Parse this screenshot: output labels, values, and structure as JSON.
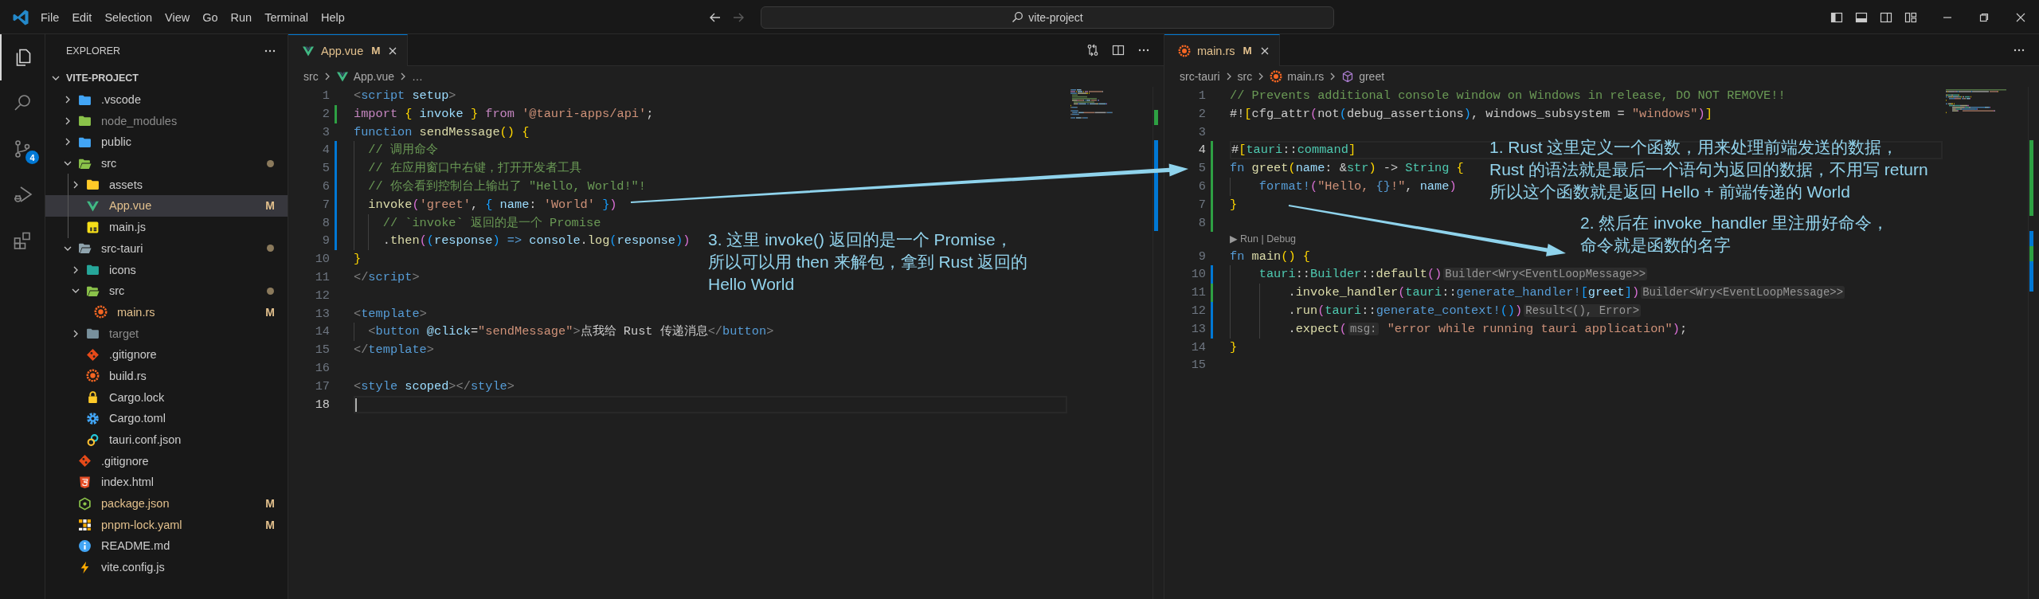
{
  "title_bar": {
    "menus": [
      "File",
      "Edit",
      "Selection",
      "View",
      "Go",
      "Run",
      "Terminal",
      "Help"
    ],
    "search": "vite-project"
  },
  "activity_bar": {
    "items": [
      {
        "selected": true
      },
      {
        "selected": false
      },
      {
        "selected": false,
        "badge": "4"
      },
      {
        "selected": false
      },
      {
        "selected": false
      }
    ]
  },
  "explorer": {
    "title": "EXPLORER",
    "root": {
      "name": "VITE-PROJECT",
      "expanded": true,
      "children": [
        {
          "name": ".vscode",
          "kind": "folder",
          "color": "#42a5f5",
          "expanded": false,
          "modified": false,
          "selected": false,
          "ignored": false
        },
        {
          "name": "node_modules",
          "kind": "folder",
          "color": "#8bc34a",
          "expanded": false,
          "modified": false,
          "selected": false,
          "ignored": true
        },
        {
          "name": "public",
          "kind": "folder",
          "color": "#42a5f5",
          "expanded": false,
          "modified": false,
          "selected": false,
          "ignored": false
        },
        {
          "name": "src",
          "kind": "folder",
          "color": "#8bc34a",
          "expanded": true,
          "modified": true,
          "selected": false,
          "ignored": false,
          "children": [
            {
              "name": "assets",
              "kind": "folder",
              "color": "#ffca28",
              "expanded": false,
              "modified": false,
              "selected": false,
              "ignored": false
            },
            {
              "name": "App.vue",
              "kind": "vue",
              "status": "M",
              "selected": true,
              "ignored": false
            },
            {
              "name": "main.js",
              "kind": "js",
              "selected": false,
              "ignored": false
            }
          ]
        },
        {
          "name": "src-tauri",
          "kind": "folder",
          "color": "#90a4ae",
          "expanded": true,
          "modified": true,
          "selected": false,
          "ignored": false,
          "children": [
            {
              "name": "icons",
              "kind": "folder",
              "color": "#26a69a",
              "expanded": false,
              "modified": false,
              "selected": false,
              "ignored": false
            },
            {
              "name": "src",
              "kind": "folder",
              "color": "#8bc34a",
              "expanded": true,
              "modified": true,
              "selected": false,
              "ignored": false,
              "children": [
                {
                  "name": "main.rs",
                  "kind": "rust",
                  "status": "M",
                  "selected": false,
                  "ignored": false
                }
              ]
            },
            {
              "name": "target",
              "kind": "folder",
              "color": "#78909c",
              "expanded": false,
              "modified": false,
              "selected": false,
              "ignored": true
            },
            {
              "name": ".gitignore",
              "kind": "git",
              "selected": false,
              "ignored": false
            },
            {
              "name": "build.rs",
              "kind": "rust",
              "selected": false,
              "ignored": false
            },
            {
              "name": "Cargo.lock",
              "kind": "lock",
              "selected": false,
              "ignored": false
            },
            {
              "name": "Cargo.toml",
              "kind": "toml",
              "selected": false,
              "ignored": false
            },
            {
              "name": "tauri.conf.json",
              "kind": "tauri",
              "selected": false,
              "ignored": false
            }
          ]
        },
        {
          "name": ".gitignore",
          "kind": "git",
          "selected": false,
          "ignored": false
        },
        {
          "name": "index.html",
          "kind": "html",
          "selected": false,
          "ignored": false
        },
        {
          "name": "package.json",
          "kind": "npm",
          "status": "M",
          "selected": false,
          "ignored": false
        },
        {
          "name": "pnpm-lock.yaml",
          "kind": "yaml",
          "status": "M",
          "selected": false,
          "ignored": false
        },
        {
          "name": "README.md",
          "kind": "info",
          "selected": false,
          "ignored": false
        },
        {
          "name": "vite.config.js",
          "kind": "vite",
          "selected": false,
          "ignored": false
        }
      ]
    }
  },
  "editors": [
    {
      "tab": {
        "label": "App.vue",
        "kind": "vue",
        "status": "M",
        "selected": true
      },
      "breadcrumb": [
        {
          "label": "src",
          "kind": "folder"
        },
        {
          "label": "App.vue",
          "kind": "vue"
        },
        {
          "label": "…",
          "kind": "more"
        }
      ],
      "lines": [
        {
          "kind": "code",
          "number": "1",
          "current": false,
          "tokens": [
            {
              "kind": "tag-punct",
              "text": "<"
            },
            {
              "kind": "tag",
              "text": "script"
            },
            {
              "kind": "attribute",
              "text": " setup"
            },
            {
              "kind": "tag-punct",
              "text": ">"
            }
          ]
        },
        {
          "kind": "code",
          "number": "2",
          "current": false,
          "color": "#2ea043",
          "tokens": [
            {
              "kind": "keyword",
              "text": "import"
            },
            {
              "kind": "bracket-1",
              "text": " {"
            },
            {
              "kind": "variable",
              "text": " invoke"
            },
            {
              "kind": "bracket-1",
              "text": " }"
            },
            {
              "kind": "keyword",
              "text": " from"
            },
            {
              "kind": "string",
              "text": " '@tauri-apps/api'"
            },
            {
              "kind": "plain",
              "text": ";"
            }
          ]
        },
        {
          "kind": "code",
          "number": "3",
          "current": false,
          "tokens": [
            {
              "kind": "storage",
              "text": "function"
            },
            {
              "kind": "function",
              "text": " sendMessage"
            },
            {
              "kind": "bracket-1",
              "text": "()"
            },
            {
              "kind": "bracket-1",
              "text": " {"
            }
          ]
        },
        {
          "kind": "code",
          "number": "4",
          "current": false,
          "color": "#0078d4",
          "tokens": [
            {
              "kind": "comment",
              "text": "  // 调用命令"
            }
          ]
        },
        {
          "kind": "code",
          "number": "5",
          "current": false,
          "color": "#0078d4",
          "tokens": [
            {
              "kind": "comment",
              "text": "  // 在应用窗口中右键，打开开发者工具"
            }
          ]
        },
        {
          "kind": "code",
          "number": "6",
          "current": false,
          "color": "#0078d4",
          "tokens": [
            {
              "kind": "comment",
              "text": "  // 你会看到控制台上输出了 \"Hello, World!\"!"
            }
          ]
        },
        {
          "kind": "code",
          "number": "7",
          "current": false,
          "color": "#0078d4",
          "tokens": [
            {
              "kind": "function",
              "text": "  invoke"
            },
            {
              "kind": "bracket-2",
              "text": "("
            },
            {
              "kind": "string",
              "text": "'greet'"
            },
            {
              "kind": "plain",
              "text": ", "
            },
            {
              "kind": "bracket-3",
              "text": "{"
            },
            {
              "kind": "variable",
              "text": " name"
            },
            {
              "kind": "plain",
              "text": ": "
            },
            {
              "kind": "string",
              "text": "'World'"
            },
            {
              "kind": "bracket-3",
              "text": " }"
            },
            {
              "kind": "bracket-2",
              "text": ")"
            }
          ]
        },
        {
          "kind": "code",
          "number": "8",
          "current": false,
          "color": "#0078d4",
          "tokens": [
            {
              "kind": "comment",
              "text": "    // `invoke` 返回的是一个 Promise"
            }
          ]
        },
        {
          "kind": "code",
          "number": "9",
          "current": false,
          "color": "#0078d4",
          "tokens": [
            {
              "kind": "plain",
              "text": "    ."
            },
            {
              "kind": "function",
              "text": "then"
            },
            {
              "kind": "bracket-2",
              "text": "("
            },
            {
              "kind": "bracket-3",
              "text": "("
            },
            {
              "kind": "variable",
              "text": "response"
            },
            {
              "kind": "bracket-3",
              "text": ")"
            },
            {
              "kind": "storage",
              "text": " =>"
            },
            {
              "kind": "variable",
              "text": " console"
            },
            {
              "kind": "plain",
              "text": "."
            },
            {
              "kind": "function",
              "text": "log"
            },
            {
              "kind": "bracket-3",
              "text": "("
            },
            {
              "kind": "variable",
              "text": "response"
            },
            {
              "kind": "bracket-3",
              "text": ")"
            },
            {
              "kind": "bracket-2",
              "text": ")"
            }
          ]
        },
        {
          "kind": "code",
          "number": "10",
          "current": false,
          "tokens": [
            {
              "kind": "bracket-1",
              "text": "}"
            }
          ]
        },
        {
          "kind": "code",
          "number": "11",
          "current": false,
          "tokens": [
            {
              "kind": "tag-punct",
              "text": "</"
            },
            {
              "kind": "tag",
              "text": "script"
            },
            {
              "kind": "tag-punct",
              "text": ">"
            }
          ]
        },
        {
          "kind": "code",
          "number": "12",
          "current": false
        },
        {
          "kind": "code",
          "number": "13",
          "current": false,
          "tokens": [
            {
              "kind": "tag-punct",
              "text": "<"
            },
            {
              "kind": "tag",
              "text": "template"
            },
            {
              "kind": "tag-punct",
              "text": ">"
            }
          ]
        },
        {
          "kind": "code",
          "number": "14",
          "current": false,
          "tokens": [
            {
              "kind": "tag-punct",
              "text": "  <"
            },
            {
              "kind": "tag",
              "text": "button"
            },
            {
              "kind": "attribute",
              "text": " @click"
            },
            {
              "kind": "plain",
              "text": "="
            },
            {
              "kind": "string",
              "text": "\"sendMessage\""
            },
            {
              "kind": "tag-punct",
              "text": ">"
            },
            {
              "kind": "plain",
              "text": "点我给 Rust 传递消息"
            },
            {
              "kind": "tag-punct",
              "text": "</"
            },
            {
              "kind": "tag",
              "text": "button"
            },
            {
              "kind": "tag-punct",
              "text": ">"
            }
          ]
        },
        {
          "kind": "code",
          "number": "15",
          "current": false,
          "tokens": [
            {
              "kind": "tag-punct",
              "text": "</"
            },
            {
              "kind": "tag",
              "text": "template"
            },
            {
              "kind": "tag-punct",
              "text": ">"
            }
          ]
        },
        {
          "kind": "code",
          "number": "16",
          "current": false
        },
        {
          "kind": "code",
          "number": "17",
          "current": false,
          "tokens": [
            {
              "kind": "tag-punct",
              "text": "<"
            },
            {
              "kind": "tag",
              "text": "style"
            },
            {
              "kind": "attribute",
              "text": " scoped"
            },
            {
              "kind": "tag-punct",
              "text": "></"
            },
            {
              "kind": "tag",
              "text": "style"
            },
            {
              "kind": "tag-punct",
              "text": ">"
            }
          ]
        },
        {
          "kind": "code",
          "number": "18",
          "current": true
        }
      ]
    },
    {
      "tab": {
        "label": "main.rs",
        "kind": "rust",
        "status": "M",
        "selected": true
      },
      "breadcrumb": [
        {
          "label": "src-tauri",
          "kind": "folder"
        },
        {
          "label": "src",
          "kind": "folder"
        },
        {
          "label": "main.rs",
          "kind": "rust"
        },
        {
          "label": "greet",
          "kind": "symbol"
        }
      ],
      "lines": [
        {
          "kind": "code",
          "number": "1",
          "current": false,
          "tokens": [
            {
              "kind": "comment",
              "text": "// Prevents additional console window on Windows in release, DO NOT REMOVE!!"
            }
          ]
        },
        {
          "kind": "code",
          "number": "2",
          "current": false,
          "tokens": [
            {
              "kind": "plain",
              "text": "#!"
            },
            {
              "kind": "bracket-1",
              "text": "["
            },
            {
              "kind": "plain",
              "text": "cfg_attr"
            },
            {
              "kind": "bracket-2",
              "text": "("
            },
            {
              "kind": "plain",
              "text": "not"
            },
            {
              "kind": "bracket-3",
              "text": "("
            },
            {
              "kind": "plain",
              "text": "debug_assertions"
            },
            {
              "kind": "bracket-3",
              "text": ")"
            },
            {
              "kind": "plain",
              "text": ", windows_subsystem = "
            },
            {
              "kind": "string",
              "text": "\"windows\""
            },
            {
              "kind": "bracket-2",
              "text": ")"
            },
            {
              "kind": "bracket-1",
              "text": "]"
            }
          ]
        },
        {
          "kind": "code",
          "number": "3",
          "current": false
        },
        {
          "kind": "code",
          "number": "4",
          "current": true,
          "color": "#2ea043",
          "tokens": [
            {
              "kind": "plain",
              "text": "#"
            },
            {
              "kind": "bracket-1",
              "text": "["
            },
            {
              "kind": "type",
              "text": "tauri"
            },
            {
              "kind": "plain",
              "text": "::"
            },
            {
              "kind": "type",
              "text": "command"
            },
            {
              "kind": "bracket-1",
              "text": "]"
            }
          ]
        },
        {
          "kind": "code",
          "number": "5",
          "current": false,
          "color": "#2ea043",
          "tokens": [
            {
              "kind": "storage",
              "text": "fn"
            },
            {
              "kind": "function",
              "text": " greet"
            },
            {
              "kind": "bracket-1",
              "text": "("
            },
            {
              "kind": "variable",
              "text": "name"
            },
            {
              "kind": "plain",
              "text": ": &"
            },
            {
              "kind": "type",
              "text": "str"
            },
            {
              "kind": "bracket-1",
              "text": ")"
            },
            {
              "kind": "plain",
              "text": " -> "
            },
            {
              "kind": "type",
              "text": "String"
            },
            {
              "kind": "bracket-1",
              "text": " {"
            }
          ]
        },
        {
          "kind": "code",
          "number": "6",
          "current": false,
          "color": "#2ea043",
          "tokens": [
            {
              "kind": "macro",
              "text": "    format!"
            },
            {
              "kind": "bracket-2",
              "text": "("
            },
            {
              "kind": "string",
              "text": "\"Hello, "
            },
            {
              "kind": "placeholder",
              "text": "{}"
            },
            {
              "kind": "string",
              "text": "!\""
            },
            {
              "kind": "plain",
              "text": ", "
            },
            {
              "kind": "variable",
              "text": "name"
            },
            {
              "kind": "bracket-2",
              "text": ")"
            }
          ]
        },
        {
          "kind": "code",
          "number": "7",
          "current": false,
          "color": "#2ea043",
          "tokens": [
            {
              "kind": "bracket-1",
              "text": "}"
            }
          ]
        },
        {
          "kind": "code",
          "number": "8",
          "current": false,
          "color": "#2ea043"
        },
        {
          "kind": "codelens",
          "text": "▶ Run | Debug"
        },
        {
          "kind": "code",
          "number": "9",
          "current": false,
          "tokens": [
            {
              "kind": "storage",
              "text": "fn"
            },
            {
              "kind": "function",
              "text": " main"
            },
            {
              "kind": "bracket-1",
              "text": "()"
            },
            {
              "kind": "bracket-1",
              "text": " {"
            }
          ]
        },
        {
          "kind": "code",
          "number": "10",
          "current": false,
          "color": "#0078d4",
          "tokens": [
            {
              "kind": "type",
              "text": "    tauri"
            },
            {
              "kind": "plain",
              "text": "::"
            },
            {
              "kind": "type",
              "text": "Builder"
            },
            {
              "kind": "plain",
              "text": "::"
            },
            {
              "kind": "function",
              "text": "default"
            },
            {
              "kind": "bracket-2",
              "text": "()"
            },
            {
              "kind": "hint",
              "text": "Builder<Wry<EventLoopMessage>>"
            }
          ]
        },
        {
          "kind": "code",
          "number": "11",
          "current": false,
          "color": "#2ea043",
          "tokens": [
            {
              "kind": "plain",
              "text": "        ."
            },
            {
              "kind": "function",
              "text": "invoke_handler"
            },
            {
              "kind": "bracket-2",
              "text": "("
            },
            {
              "kind": "type",
              "text": "tauri"
            },
            {
              "kind": "plain",
              "text": "::"
            },
            {
              "kind": "macro",
              "text": "generate_handler!"
            },
            {
              "kind": "bracket-3",
              "text": "["
            },
            {
              "kind": "variable",
              "text": "greet"
            },
            {
              "kind": "bracket-3",
              "text": "]"
            },
            {
              "kind": "bracket-2",
              "text": ")"
            },
            {
              "kind": "hint",
              "text": "Builder<Wry<EventLoopMessage>>"
            }
          ]
        },
        {
          "kind": "code",
          "number": "12",
          "current": false,
          "color": "#0078d4",
          "tokens": [
            {
              "kind": "plain",
              "text": "        ."
            },
            {
              "kind": "function",
              "text": "run"
            },
            {
              "kind": "bracket-2",
              "text": "("
            },
            {
              "kind": "type",
              "text": "tauri"
            },
            {
              "kind": "plain",
              "text": "::"
            },
            {
              "kind": "macro",
              "text": "generate_context!"
            },
            {
              "kind": "bracket-3",
              "text": "()"
            },
            {
              "kind": "bracket-2",
              "text": ")"
            },
            {
              "kind": "hint",
              "text": "Result<(), Error>"
            }
          ]
        },
        {
          "kind": "code",
          "number": "13",
          "current": false,
          "color": "#0078d4",
          "tokens": [
            {
              "kind": "plain",
              "text": "        ."
            },
            {
              "kind": "function",
              "text": "expect"
            },
            {
              "kind": "bracket-2",
              "text": "("
            },
            {
              "kind": "hint",
              "text": "msg:"
            },
            {
              "kind": "string",
              "text": " \"error while running tauri application\""
            },
            {
              "kind": "bracket-2",
              "text": ")"
            },
            {
              "kind": "plain",
              "text": ";"
            }
          ]
        },
        {
          "kind": "code",
          "number": "14",
          "current": false,
          "tokens": [
            {
              "kind": "bracket-1",
              "text": "}"
            }
          ]
        },
        {
          "kind": "code",
          "number": "15",
          "current": false
        }
      ]
    }
  ],
  "annotations": [
    {
      "lines": [
        "1. Rust 这里定义一个函数，用来处理前端发送的数据，",
        "Rust 的语法就是最后一个语句为返回的数据，不用写 return",
        "所以这个函数就是返回 Hello + 前端传递的 World"
      ]
    },
    {
      "lines": [
        "2. 然后在 invoke_handler 里注册好命令，",
        "命令就是函数的名字"
      ]
    },
    {
      "lines": [
        "3. 这里 invoke() 返回的是一个 Promise，",
        "所以可以用 then 来解包，拿到 Rust 返回的",
        "Hello World"
      ]
    }
  ]
}
